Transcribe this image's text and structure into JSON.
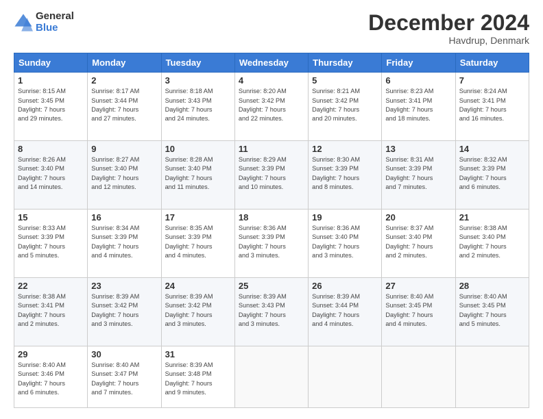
{
  "logo": {
    "general": "General",
    "blue": "Blue"
  },
  "title": "December 2024",
  "location": "Havdrup, Denmark",
  "days_header": [
    "Sunday",
    "Monday",
    "Tuesday",
    "Wednesday",
    "Thursday",
    "Friday",
    "Saturday"
  ],
  "weeks": [
    [
      {
        "day": "1",
        "sunrise": "8:15 AM",
        "sunset": "3:45 PM",
        "daylight_hours": "7",
        "daylight_minutes": "29"
      },
      {
        "day": "2",
        "sunrise": "8:17 AM",
        "sunset": "3:44 PM",
        "daylight_hours": "7",
        "daylight_minutes": "27"
      },
      {
        "day": "3",
        "sunrise": "8:18 AM",
        "sunset": "3:43 PM",
        "daylight_hours": "7",
        "daylight_minutes": "24"
      },
      {
        "day": "4",
        "sunrise": "8:20 AM",
        "sunset": "3:42 PM",
        "daylight_hours": "7",
        "daylight_minutes": "22"
      },
      {
        "day": "5",
        "sunrise": "8:21 AM",
        "sunset": "3:42 PM",
        "daylight_hours": "7",
        "daylight_minutes": "20"
      },
      {
        "day": "6",
        "sunrise": "8:23 AM",
        "sunset": "3:41 PM",
        "daylight_hours": "7",
        "daylight_minutes": "18"
      },
      {
        "day": "7",
        "sunrise": "8:24 AM",
        "sunset": "3:41 PM",
        "daylight_hours": "7",
        "daylight_minutes": "16"
      }
    ],
    [
      {
        "day": "8",
        "sunrise": "8:26 AM",
        "sunset": "3:40 PM",
        "daylight_hours": "7",
        "daylight_minutes": "14"
      },
      {
        "day": "9",
        "sunrise": "8:27 AM",
        "sunset": "3:40 PM",
        "daylight_hours": "7",
        "daylight_minutes": "12"
      },
      {
        "day": "10",
        "sunrise": "8:28 AM",
        "sunset": "3:40 PM",
        "daylight_hours": "7",
        "daylight_minutes": "11"
      },
      {
        "day": "11",
        "sunrise": "8:29 AM",
        "sunset": "3:39 PM",
        "daylight_hours": "7",
        "daylight_minutes": "10"
      },
      {
        "day": "12",
        "sunrise": "8:30 AM",
        "sunset": "3:39 PM",
        "daylight_hours": "7",
        "daylight_minutes": "8"
      },
      {
        "day": "13",
        "sunrise": "8:31 AM",
        "sunset": "3:39 PM",
        "daylight_hours": "7",
        "daylight_minutes": "7"
      },
      {
        "day": "14",
        "sunrise": "8:32 AM",
        "sunset": "3:39 PM",
        "daylight_hours": "7",
        "daylight_minutes": "6"
      }
    ],
    [
      {
        "day": "15",
        "sunrise": "8:33 AM",
        "sunset": "3:39 PM",
        "daylight_hours": "7",
        "daylight_minutes": "5"
      },
      {
        "day": "16",
        "sunrise": "8:34 AM",
        "sunset": "3:39 PM",
        "daylight_hours": "7",
        "daylight_minutes": "4"
      },
      {
        "day": "17",
        "sunrise": "8:35 AM",
        "sunset": "3:39 PM",
        "daylight_hours": "7",
        "daylight_minutes": "4"
      },
      {
        "day": "18",
        "sunrise": "8:36 AM",
        "sunset": "3:39 PM",
        "daylight_hours": "7",
        "daylight_minutes": "3"
      },
      {
        "day": "19",
        "sunrise": "8:36 AM",
        "sunset": "3:40 PM",
        "daylight_hours": "7",
        "daylight_minutes": "3"
      },
      {
        "day": "20",
        "sunrise": "8:37 AM",
        "sunset": "3:40 PM",
        "daylight_hours": "7",
        "daylight_minutes": "2"
      },
      {
        "day": "21",
        "sunrise": "8:38 AM",
        "sunset": "3:40 PM",
        "daylight_hours": "7",
        "daylight_minutes": "2"
      }
    ],
    [
      {
        "day": "22",
        "sunrise": "8:38 AM",
        "sunset": "3:41 PM",
        "daylight_hours": "7",
        "daylight_minutes": "2"
      },
      {
        "day": "23",
        "sunrise": "8:39 AM",
        "sunset": "3:42 PM",
        "daylight_hours": "7",
        "daylight_minutes": "3"
      },
      {
        "day": "24",
        "sunrise": "8:39 AM",
        "sunset": "3:42 PM",
        "daylight_hours": "7",
        "daylight_minutes": "3"
      },
      {
        "day": "25",
        "sunrise": "8:39 AM",
        "sunset": "3:43 PM",
        "daylight_hours": "7",
        "daylight_minutes": "3"
      },
      {
        "day": "26",
        "sunrise": "8:39 AM",
        "sunset": "3:44 PM",
        "daylight_hours": "7",
        "daylight_minutes": "4"
      },
      {
        "day": "27",
        "sunrise": "8:40 AM",
        "sunset": "3:45 PM",
        "daylight_hours": "7",
        "daylight_minutes": "4"
      },
      {
        "day": "28",
        "sunrise": "8:40 AM",
        "sunset": "3:45 PM",
        "daylight_hours": "7",
        "daylight_minutes": "5"
      }
    ],
    [
      {
        "day": "29",
        "sunrise": "8:40 AM",
        "sunset": "3:46 PM",
        "daylight_hours": "7",
        "daylight_minutes": "6"
      },
      {
        "day": "30",
        "sunrise": "8:40 AM",
        "sunset": "3:47 PM",
        "daylight_hours": "7",
        "daylight_minutes": "7"
      },
      {
        "day": "31",
        "sunrise": "8:39 AM",
        "sunset": "3:48 PM",
        "daylight_hours": "7",
        "daylight_minutes": "9"
      },
      null,
      null,
      null,
      null
    ]
  ]
}
